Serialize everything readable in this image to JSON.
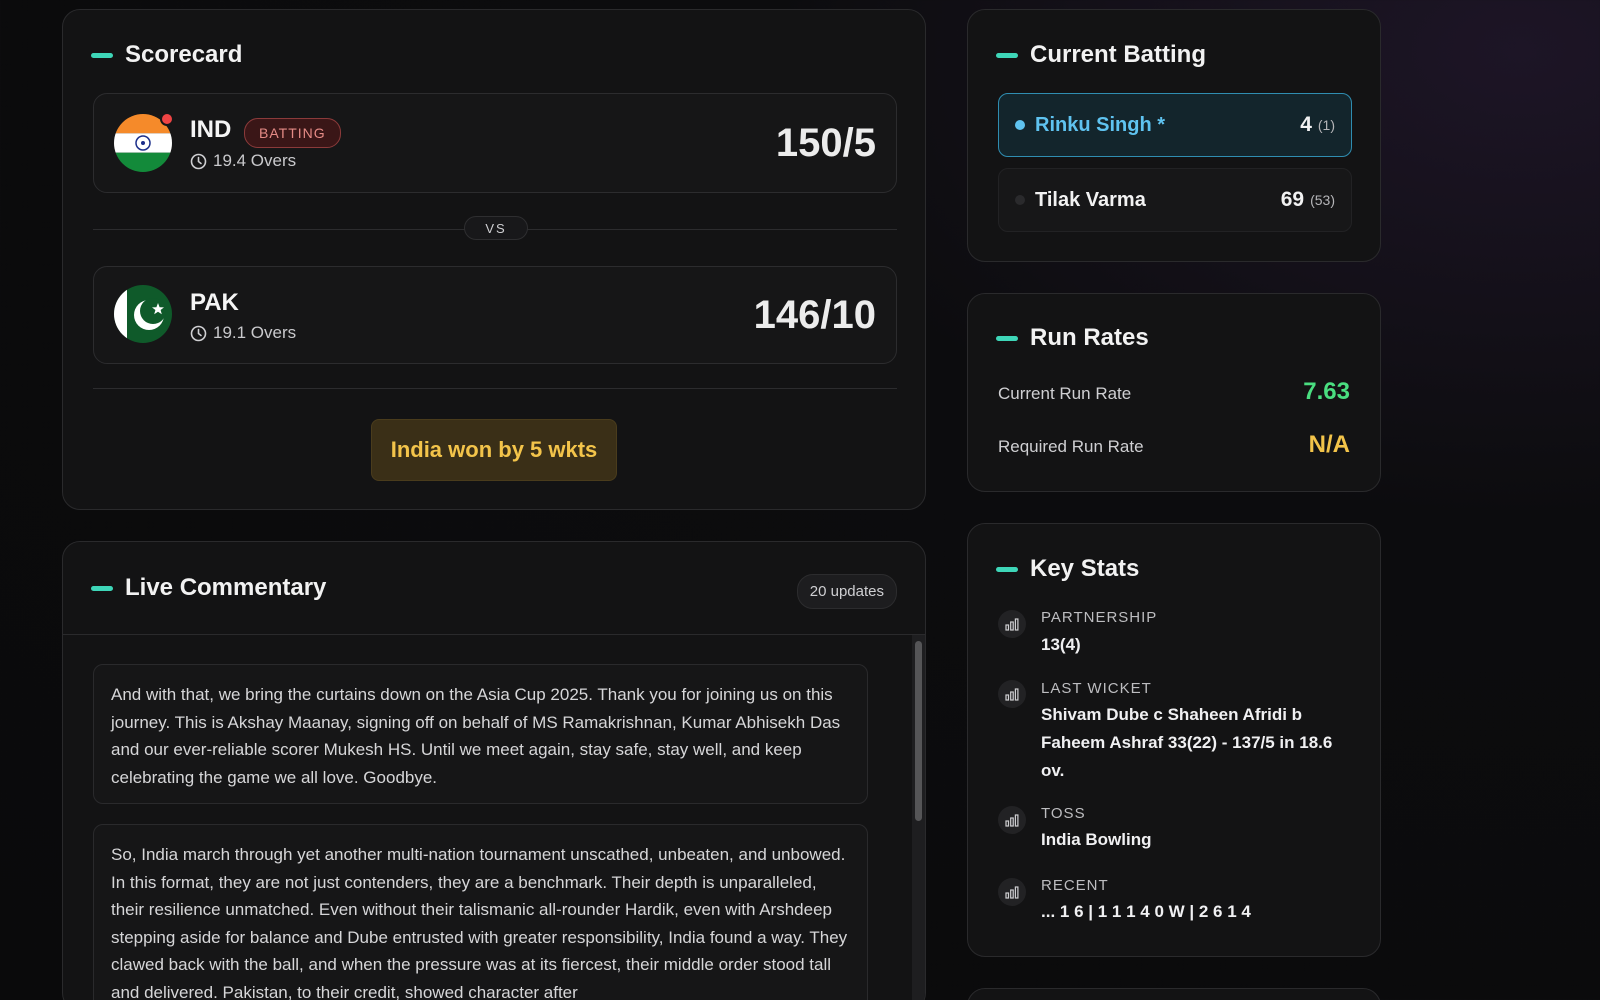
{
  "scorecard": {
    "title": "Scorecard",
    "team1": {
      "code": "IND",
      "badge": "BATTING",
      "overs": "19.4 Overs",
      "score": "150/5"
    },
    "vs": "VS",
    "team2": {
      "code": "PAK",
      "overs": "19.1 Overs",
      "score": "146/10"
    },
    "result": "India won by 5 wkts"
  },
  "commentary": {
    "title": "Live Commentary",
    "updates": "20 updates",
    "items": [
      "And with that, we bring the curtains down on the Asia Cup 2025. Thank you for joining us on this journey. This is Akshay Maanay, signing off on behalf of MS Ramakrishnan, Kumar Abhisekh Das and our ever-reliable scorer Mukesh HS. Until we meet again, stay safe, stay well, and keep celebrating the game we all love. Goodbye.",
      "So, India march through yet another multi-nation tournament unscathed, unbeaten, and unbowed. In this format, they are not just contenders, they are a benchmark. Their depth is unparalleled, their resilience unmatched. Even without their talismanic all-rounder Hardik, even with Arshdeep stepping aside for balance and Dube entrusted with greater responsibility, India found a way. They clawed back with the ball, and when the pressure was at its fiercest, their middle order stood tall and delivered. Pakistan, to their credit, showed character after"
    ]
  },
  "batting": {
    "title": "Current Batting",
    "batters": [
      {
        "name": "Rinku Singh *",
        "runs": "4",
        "balls": "(1)"
      },
      {
        "name": "Tilak Varma",
        "runs": "69",
        "balls": "(53)"
      }
    ]
  },
  "run_rates": {
    "title": "Run Rates",
    "current_label": "Current Run Rate",
    "current_value": "7.63",
    "required_label": "Required Run Rate",
    "required_value": "N/A"
  },
  "key_stats": {
    "title": "Key Stats",
    "items": [
      {
        "label": "PARTNERSHIP",
        "value": "13(4)"
      },
      {
        "label": "LAST WICKET",
        "value": "Shivam Dube c Shaheen Afridi b Faheem Ashraf 33(22) - 137/5 in 18.6 ov."
      },
      {
        "label": "TOSS",
        "value": "India Bowling"
      },
      {
        "label": "RECENT",
        "value": "... 1 6 | 1 1 1 4 0 W | 2 6 1 4"
      }
    ]
  },
  "colors": {
    "accent": "#3ed6b8",
    "live": "#ef4444",
    "current_rr": "#4ade80",
    "required_rr": "#f3c44a",
    "result": "#f3c44a",
    "active_batter": "#5fc3f0"
  }
}
